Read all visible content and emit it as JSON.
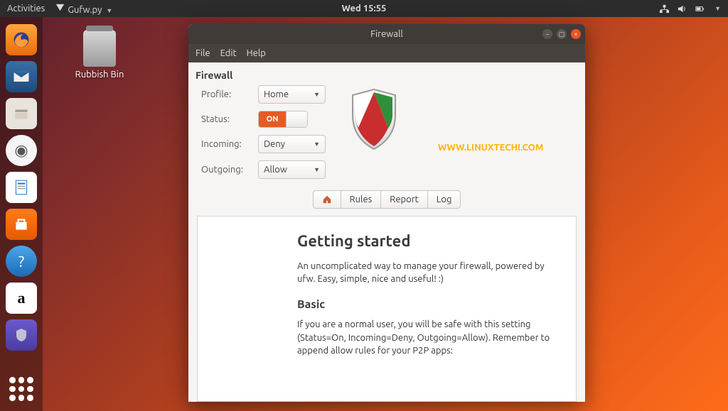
{
  "topbar": {
    "activities": "Activities",
    "app_indicator": "Gufw.py",
    "clock": "Wed 15:55"
  },
  "desktop": {
    "trash_label": "Rubbish Bin"
  },
  "window": {
    "title": "Firewall",
    "menu": {
      "file": "File",
      "edit": "Edit",
      "help": "Help"
    },
    "section": "Firewall",
    "labels": {
      "profile": "Profile:",
      "status": "Status:",
      "incoming": "Incoming:",
      "outgoing": "Outgoing:"
    },
    "values": {
      "profile": "Home",
      "status_on": "ON",
      "incoming": "Deny",
      "outgoing": "Allow"
    },
    "tabs": {
      "rules": "Rules",
      "report": "Report",
      "log": "Log"
    },
    "doc": {
      "h1": "Getting started",
      "p1": "An uncomplicated way to manage your firewall, powered by ufw. Easy, simple, nice and useful! :)",
      "h2": "Basic",
      "p2": "If you are a normal user, you will be safe with this setting (Status=On, Incoming=Deny, Outgoing=Allow). Remember to append allow rules for your P2P apps:"
    }
  },
  "watermark": "WWW.LINUXTECHI.COM"
}
